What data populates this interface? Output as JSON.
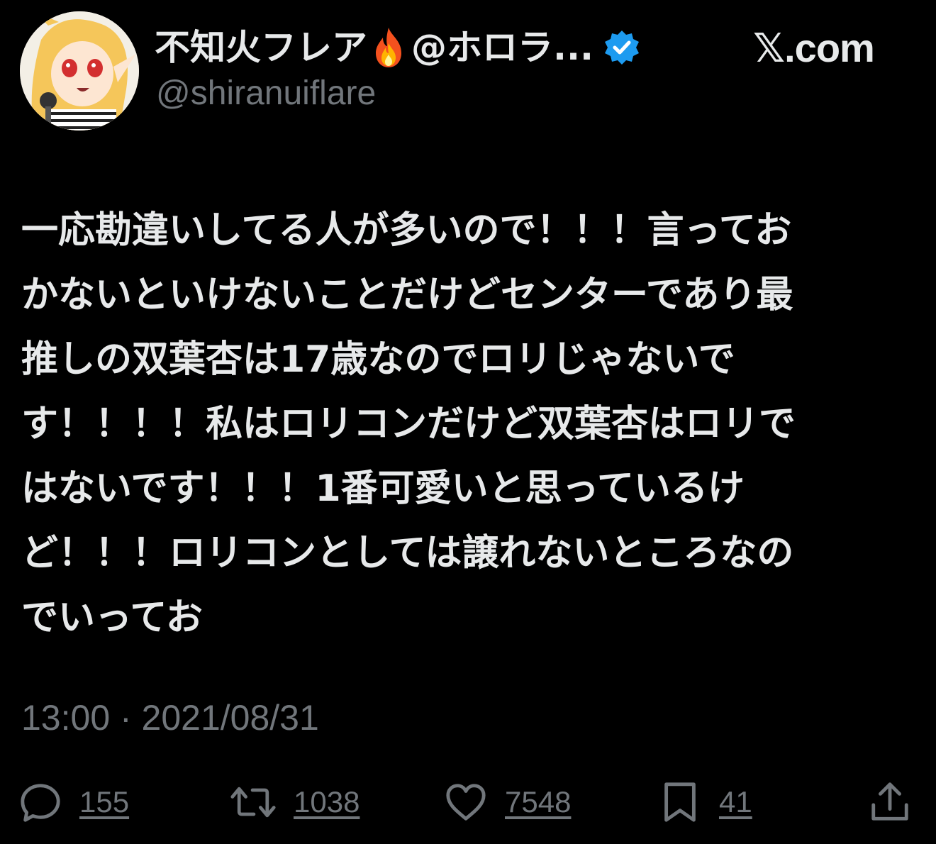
{
  "header": {
    "display_name_prefix": "不知火フレア",
    "display_name_suffix": "@ホロラ...",
    "handle": "@shiranuiflare",
    "brand": "𝕏.com"
  },
  "tweet": {
    "text": "一応勘違いしてる人が多いので！！！言ってお\nかないといけないことだけどセンターであり最\n推しの双葉杏は17歳なのでロリじゃないで\nす！！！！私はロリコンだけど双葉杏はロリで\nはないです！！！1番可愛いと思っているけ\nど！！！ロリコンとしては譲れないところなの\nでいってお",
    "timestamp": "13:00 · 2021/08/31"
  },
  "actions": {
    "reply_count": "155",
    "retweet_count": "1038",
    "like_count": "7548",
    "bookmark_count": "41"
  },
  "icons": {
    "fire": "fire-icon",
    "verified": "verified-badge-icon",
    "reply": "reply-icon",
    "retweet": "retweet-icon",
    "like": "heart-icon",
    "bookmark": "bookmark-icon",
    "share": "share-icon"
  },
  "colors": {
    "background": "#000000",
    "text": "#e7e9ea",
    "muted": "#71767b",
    "verified": "#1d9bf0"
  }
}
